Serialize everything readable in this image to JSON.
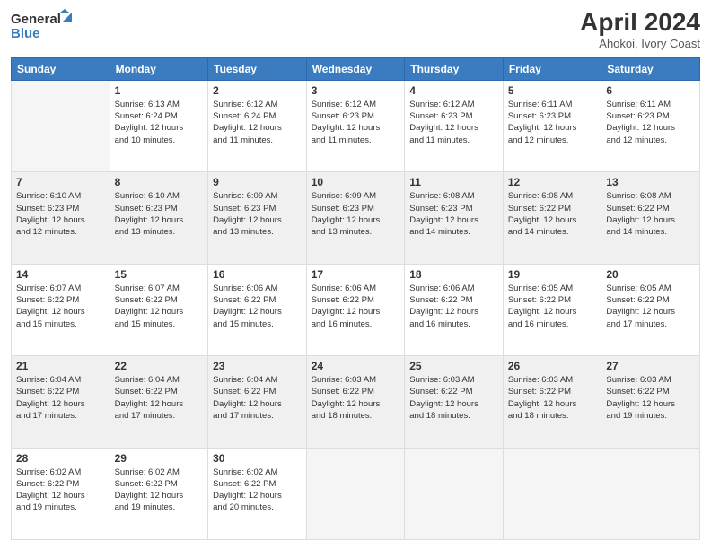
{
  "logo": {
    "general": "General",
    "blue": "Blue"
  },
  "title": "April 2024",
  "subtitle": "Ahokoi, Ivory Coast",
  "days_header": [
    "Sunday",
    "Monday",
    "Tuesday",
    "Wednesday",
    "Thursday",
    "Friday",
    "Saturday"
  ],
  "weeks": [
    [
      {
        "day": "",
        "info": ""
      },
      {
        "day": "1",
        "info": "Sunrise: 6:13 AM\nSunset: 6:24 PM\nDaylight: 12 hours\nand 10 minutes."
      },
      {
        "day": "2",
        "info": "Sunrise: 6:12 AM\nSunset: 6:24 PM\nDaylight: 12 hours\nand 11 minutes."
      },
      {
        "day": "3",
        "info": "Sunrise: 6:12 AM\nSunset: 6:23 PM\nDaylight: 12 hours\nand 11 minutes."
      },
      {
        "day": "4",
        "info": "Sunrise: 6:12 AM\nSunset: 6:23 PM\nDaylight: 12 hours\nand 11 minutes."
      },
      {
        "day": "5",
        "info": "Sunrise: 6:11 AM\nSunset: 6:23 PM\nDaylight: 12 hours\nand 12 minutes."
      },
      {
        "day": "6",
        "info": "Sunrise: 6:11 AM\nSunset: 6:23 PM\nDaylight: 12 hours\nand 12 minutes."
      }
    ],
    [
      {
        "day": "7",
        "info": "Sunrise: 6:10 AM\nSunset: 6:23 PM\nDaylight: 12 hours\nand 12 minutes."
      },
      {
        "day": "8",
        "info": "Sunrise: 6:10 AM\nSunset: 6:23 PM\nDaylight: 12 hours\nand 13 minutes."
      },
      {
        "day": "9",
        "info": "Sunrise: 6:09 AM\nSunset: 6:23 PM\nDaylight: 12 hours\nand 13 minutes."
      },
      {
        "day": "10",
        "info": "Sunrise: 6:09 AM\nSunset: 6:23 PM\nDaylight: 12 hours\nand 13 minutes."
      },
      {
        "day": "11",
        "info": "Sunrise: 6:08 AM\nSunset: 6:23 PM\nDaylight: 12 hours\nand 14 minutes."
      },
      {
        "day": "12",
        "info": "Sunrise: 6:08 AM\nSunset: 6:22 PM\nDaylight: 12 hours\nand 14 minutes."
      },
      {
        "day": "13",
        "info": "Sunrise: 6:08 AM\nSunset: 6:22 PM\nDaylight: 12 hours\nand 14 minutes."
      }
    ],
    [
      {
        "day": "14",
        "info": "Sunrise: 6:07 AM\nSunset: 6:22 PM\nDaylight: 12 hours\nand 15 minutes."
      },
      {
        "day": "15",
        "info": "Sunrise: 6:07 AM\nSunset: 6:22 PM\nDaylight: 12 hours\nand 15 minutes."
      },
      {
        "day": "16",
        "info": "Sunrise: 6:06 AM\nSunset: 6:22 PM\nDaylight: 12 hours\nand 15 minutes."
      },
      {
        "day": "17",
        "info": "Sunrise: 6:06 AM\nSunset: 6:22 PM\nDaylight: 12 hours\nand 16 minutes."
      },
      {
        "day": "18",
        "info": "Sunrise: 6:06 AM\nSunset: 6:22 PM\nDaylight: 12 hours\nand 16 minutes."
      },
      {
        "day": "19",
        "info": "Sunrise: 6:05 AM\nSunset: 6:22 PM\nDaylight: 12 hours\nand 16 minutes."
      },
      {
        "day": "20",
        "info": "Sunrise: 6:05 AM\nSunset: 6:22 PM\nDaylight: 12 hours\nand 17 minutes."
      }
    ],
    [
      {
        "day": "21",
        "info": "Sunrise: 6:04 AM\nSunset: 6:22 PM\nDaylight: 12 hours\nand 17 minutes."
      },
      {
        "day": "22",
        "info": "Sunrise: 6:04 AM\nSunset: 6:22 PM\nDaylight: 12 hours\nand 17 minutes."
      },
      {
        "day": "23",
        "info": "Sunrise: 6:04 AM\nSunset: 6:22 PM\nDaylight: 12 hours\nand 17 minutes."
      },
      {
        "day": "24",
        "info": "Sunrise: 6:03 AM\nSunset: 6:22 PM\nDaylight: 12 hours\nand 18 minutes."
      },
      {
        "day": "25",
        "info": "Sunrise: 6:03 AM\nSunset: 6:22 PM\nDaylight: 12 hours\nand 18 minutes."
      },
      {
        "day": "26",
        "info": "Sunrise: 6:03 AM\nSunset: 6:22 PM\nDaylight: 12 hours\nand 18 minutes."
      },
      {
        "day": "27",
        "info": "Sunrise: 6:03 AM\nSunset: 6:22 PM\nDaylight: 12 hours\nand 19 minutes."
      }
    ],
    [
      {
        "day": "28",
        "info": "Sunrise: 6:02 AM\nSunset: 6:22 PM\nDaylight: 12 hours\nand 19 minutes."
      },
      {
        "day": "29",
        "info": "Sunrise: 6:02 AM\nSunset: 6:22 PM\nDaylight: 12 hours\nand 19 minutes."
      },
      {
        "day": "30",
        "info": "Sunrise: 6:02 AM\nSunset: 6:22 PM\nDaylight: 12 hours\nand 20 minutes."
      },
      {
        "day": "",
        "info": ""
      },
      {
        "day": "",
        "info": ""
      },
      {
        "day": "",
        "info": ""
      },
      {
        "day": "",
        "info": ""
      }
    ]
  ]
}
